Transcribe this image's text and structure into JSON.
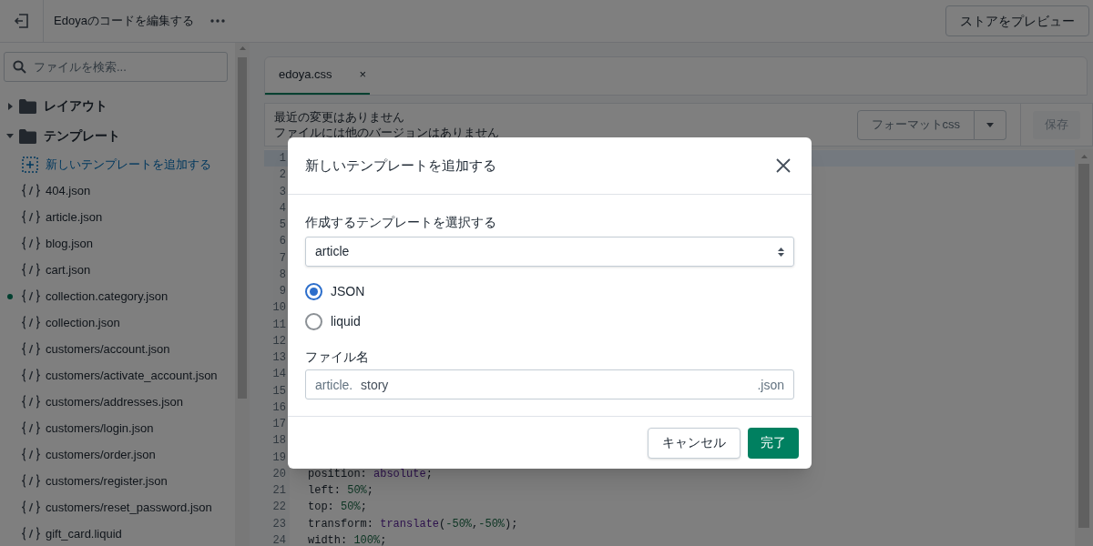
{
  "top_bar": {
    "title": "Edoyaのコードを編集する",
    "preview_button": "ストアをプレビュー"
  },
  "sidebar": {
    "search": {
      "placeholder": "ファイルを検索..."
    },
    "items": [
      {
        "kind": "folder",
        "label": "レイアウト",
        "expanded": false
      },
      {
        "kind": "folder",
        "label": "テンプレート",
        "expanded": true,
        "children": [
          {
            "kind": "add",
            "label": "新しいテンプレートを追加する"
          },
          {
            "kind": "file",
            "label": "404.json",
            "modified": false
          },
          {
            "kind": "file",
            "label": "article.json",
            "modified": false
          },
          {
            "kind": "file",
            "label": "blog.json",
            "modified": false
          },
          {
            "kind": "file",
            "label": "cart.json",
            "modified": false
          },
          {
            "kind": "file",
            "label": "collection.category.json",
            "modified": true
          },
          {
            "kind": "file",
            "label": "collection.json",
            "modified": false
          },
          {
            "kind": "file",
            "label": "customers/account.json",
            "modified": false
          },
          {
            "kind": "file",
            "label": "customers/activate_account.json",
            "modified": false
          },
          {
            "kind": "file",
            "label": "customers/addresses.json",
            "modified": false
          },
          {
            "kind": "file",
            "label": "customers/login.json",
            "modified": false
          },
          {
            "kind": "file",
            "label": "customers/order.json",
            "modified": false
          },
          {
            "kind": "file",
            "label": "customers/register.json",
            "modified": false
          },
          {
            "kind": "file",
            "label": "customers/reset_password.json",
            "modified": false
          },
          {
            "kind": "file",
            "label": "gift_card.liquid",
            "modified": false
          }
        ]
      }
    ]
  },
  "editor": {
    "tabs": [
      {
        "label": "edoya.css",
        "close": "×",
        "selected": true
      }
    ],
    "status": [
      "最近の変更はありません",
      "ファイルには他のバージョンはありません"
    ],
    "format_button": "フォーマットcss",
    "save_button": "保存",
    "lines": [
      {
        "number": "1",
        "active": true
      },
      {
        "number": "2",
        "active": false
      },
      {
        "number": "3",
        "active": false
      },
      {
        "number": "4",
        "active": false
      },
      {
        "number": "5",
        "active": false
      },
      {
        "number": "6",
        "active": false
      },
      {
        "number": "7",
        "active": false
      },
      {
        "number": "8",
        "active": false
      },
      {
        "number": "9",
        "active": false
      },
      {
        "number": "10",
        "active": false
      },
      {
        "number": "11",
        "active": false
      },
      {
        "number": "12",
        "active": false
      },
      {
        "number": "13",
        "active": false
      },
      {
        "number": "14",
        "active": false
      },
      {
        "number": "15",
        "active": false
      },
      {
        "number": "16",
        "active": false
      },
      {
        "number": "17",
        "active": false
      },
      {
        "number": "18",
        "active": false
      },
      {
        "number": "19",
        "active": false
      },
      {
        "number": "20",
        "active": false,
        "tokens": [
          {
            "kind": "plain",
            "text": "position: "
          },
          {
            "kind": "keyword",
            "text": "absolute"
          },
          {
            "kind": "plain",
            "text": ";"
          }
        ]
      },
      {
        "number": "21",
        "active": false,
        "tokens": [
          {
            "kind": "plain",
            "text": "left: "
          },
          {
            "kind": "number",
            "text": "50%"
          },
          {
            "kind": "plain",
            "text": ";"
          }
        ]
      },
      {
        "number": "22",
        "active": false,
        "tokens": [
          {
            "kind": "plain",
            "text": "top: "
          },
          {
            "kind": "number",
            "text": "50%"
          },
          {
            "kind": "plain",
            "text": ";"
          }
        ]
      },
      {
        "number": "23",
        "active": false,
        "tokens": [
          {
            "kind": "plain",
            "text": "transform: "
          },
          {
            "kind": "keyword",
            "text": "translate"
          },
          {
            "kind": "plain",
            "text": "("
          },
          {
            "kind": "number",
            "text": "-50%"
          },
          {
            "kind": "plain",
            "text": ","
          },
          {
            "kind": "number",
            "text": "-50%"
          },
          {
            "kind": "plain",
            "text": ");"
          }
        ]
      },
      {
        "number": "24",
        "active": false,
        "tokens": [
          {
            "kind": "plain",
            "text": "width: "
          },
          {
            "kind": "number",
            "text": "100%"
          },
          {
            "kind": "plain",
            "text": ";"
          }
        ]
      }
    ]
  },
  "dialog": {
    "title": "新しいテンプレートを追加する",
    "select": {
      "label": "作成するテンプレートを選択する",
      "value": "article"
    },
    "radios": [
      {
        "label": "JSON",
        "selected": true
      },
      {
        "label": "liquid",
        "selected": false
      }
    ],
    "filename": {
      "label": "ファイル名",
      "prefix": "article.",
      "value": "story",
      "suffix": ".json"
    },
    "buttons": [
      {
        "kind": "secondary",
        "label": "キャンセル"
      },
      {
        "kind": "primary",
        "label": "完了"
      }
    ]
  }
}
